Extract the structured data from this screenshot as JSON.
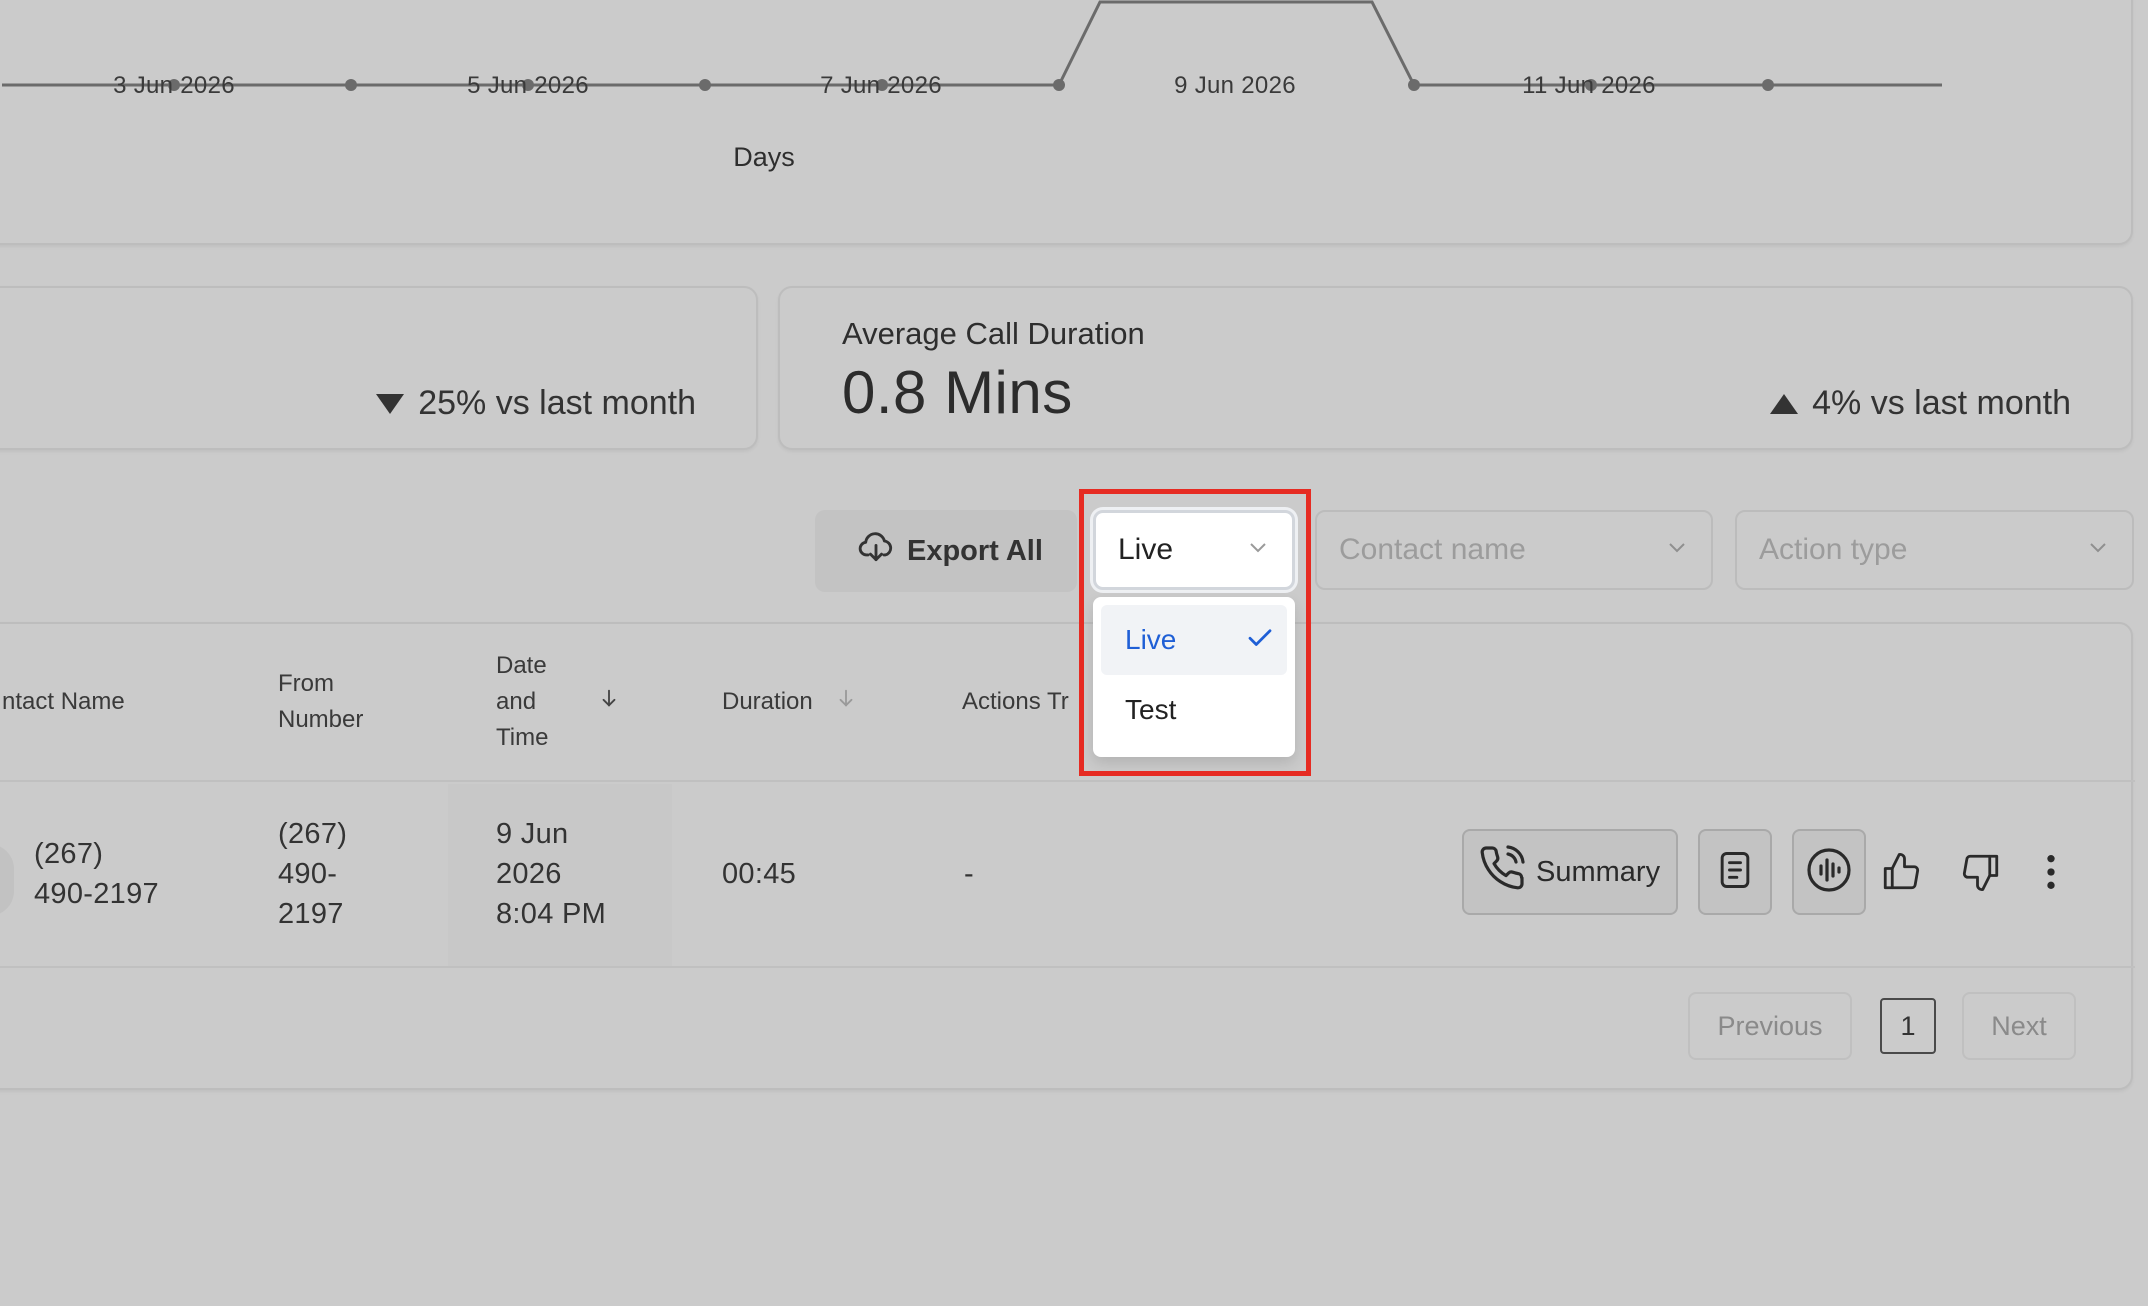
{
  "chart": {
    "x_ticks": [
      "3 Jun 2026",
      "5 Jun 2026",
      "7 Jun 2026",
      "9 Jun 2026",
      "11 Jun 2026"
    ],
    "x_axis_title": "Days"
  },
  "stats": {
    "left": {
      "trend_direction": "down",
      "trend_text": "25% vs last month"
    },
    "right": {
      "title": "Average Call Duration",
      "value": "0.8 Mins",
      "trend_direction": "up",
      "trend_text": "4% vs last month"
    }
  },
  "toolbar": {
    "export_label": "Export All",
    "environment_select": {
      "value": "Live",
      "options": [
        {
          "label": "Live",
          "selected": true
        },
        {
          "label": "Test",
          "selected": false
        }
      ]
    },
    "contact_placeholder": "Contact name",
    "action_placeholder": "Action type"
  },
  "table": {
    "headers": {
      "contact_name": "ntact Name",
      "from_number_1": "From",
      "from_number_2": "Number",
      "date_1": "Date",
      "date_2": "and",
      "date_3": "Time",
      "duration": "Duration",
      "actions": "Actions Tr"
    },
    "rows": [
      {
        "contact_1": "(267)",
        "contact_2": "490-2197",
        "from_1": "(267)",
        "from_2": "490-",
        "from_3": "2197",
        "date_1": "9 Jun",
        "date_2": "2026",
        "date_3": "8:04 PM",
        "duration": "00:45",
        "actions": "-",
        "summary_label": "Summary"
      }
    ],
    "pagination": {
      "previous": "Previous",
      "current": "1",
      "next": "Next"
    }
  },
  "colors": {
    "overlay_bg": "#cbcbcb",
    "selected_option": "#1f5fd6",
    "highlight_border": "#e62b22"
  }
}
